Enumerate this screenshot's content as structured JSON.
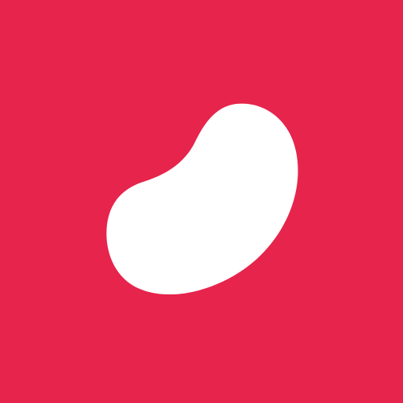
{
  "icon": {
    "name": "bean-logo-icon",
    "background_color": "#E6244C",
    "shape_color": "#FFFFFF"
  }
}
